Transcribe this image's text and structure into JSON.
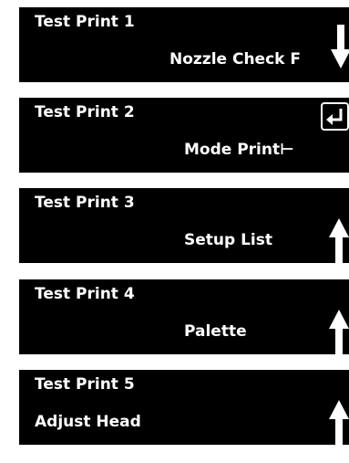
{
  "screens": [
    {
      "title": "Test Print 1",
      "value": "Nozzle Check F",
      "icon": "arrow-down-icon"
    },
    {
      "title": "Test Print 2",
      "value": "Mode Print⊢",
      "icon": "enter-icon"
    },
    {
      "title": "Test Print 3",
      "value": "Setup List",
      "icon": "arrow-up-icon"
    },
    {
      "title": "Test Print 4",
      "value": "Palette",
      "icon": "arrow-up-icon"
    },
    {
      "title": "Test Print 5",
      "value": "Adjust Head",
      "icon": "arrow-up-icon"
    }
  ],
  "colors": {
    "panel_bg": "#000000",
    "text": "#ffffff",
    "page_bg": "#ffffff"
  }
}
